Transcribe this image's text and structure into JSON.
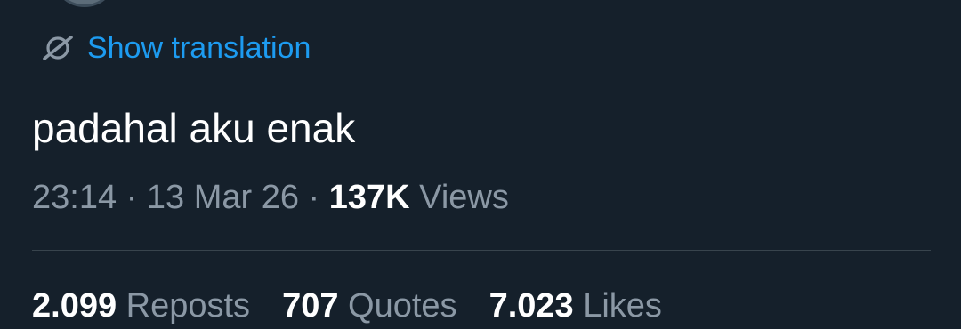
{
  "translation": {
    "label": "Show translation",
    "icon": "translate-globe-icon",
    "color": "#1d9bf0"
  },
  "tweet": {
    "text": "padahal aku enak",
    "time": "23:14",
    "separator": "·",
    "date": "13 Mar 26",
    "views_count": "137K",
    "views_label": "Views"
  },
  "stats": [
    {
      "count": "2.099",
      "label": "Reposts"
    },
    {
      "count": "707",
      "label": "Quotes"
    },
    {
      "count": "7.023",
      "label": "Likes"
    }
  ],
  "theme": {
    "background": "#15202b",
    "text": "#ffffff",
    "secondary": "#8b98a5",
    "divider": "#38444d"
  }
}
